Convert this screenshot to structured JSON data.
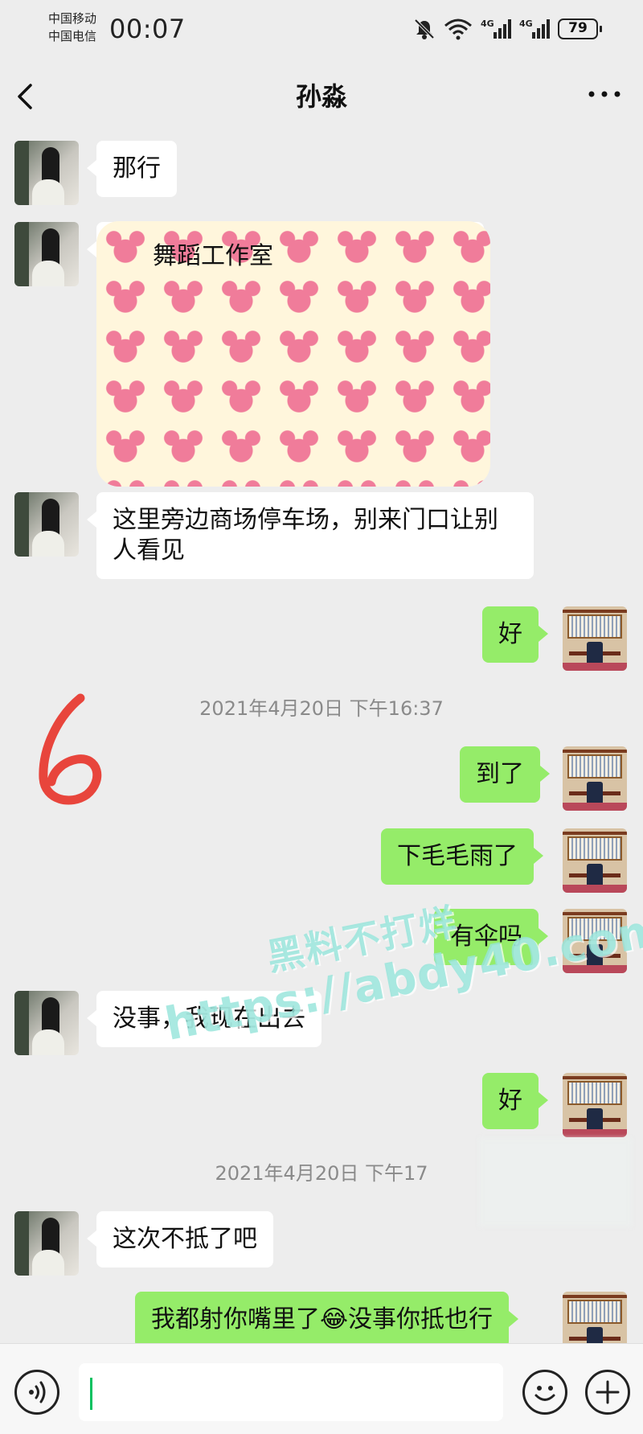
{
  "status_bar": {
    "carrier_1": "中国移动",
    "carrier_2": "中国电信",
    "time": "00:07",
    "battery": "79",
    "icons": [
      "mute-bell-icon",
      "wifi-icon",
      "signal-4g-icon",
      "signal-4g-icon",
      "battery-icon"
    ]
  },
  "header": {
    "title": "孙淼",
    "back_icon": "chevron-left-icon",
    "more_icon": "more-dots-icon"
  },
  "messages": {
    "m1": "那行",
    "m2_card_title": "舞蹈工作室",
    "m3": "这里旁边商场停车场，别来门口让别人看见",
    "m4": "好",
    "ts1": "2021年4月20日 下午16:37",
    "m5": "到了",
    "m6": "下毛毛雨了",
    "m7": "有伞吗",
    "m8": "没事，我现在出去",
    "m9": "好",
    "ts2": "2021年4月20日 下午17",
    "m10": "这次不抵了吧",
    "m11_before": "我都射你嘴里了",
    "m11_emoji": "😂",
    "m11_after": "没事你抵也行"
  },
  "annotation": {
    "number": "6"
  },
  "watermark": {
    "line1": "黑料不打烊",
    "line2": "https://abdy40.com"
  },
  "input_bar": {
    "voice_icon": "voice-icon",
    "emoji_icon": "smiley-icon",
    "plus_icon": "plus-icon",
    "value": ""
  },
  "colors": {
    "background": "#ededed",
    "incoming_bubble": "#ffffff",
    "outgoing_bubble": "#95ec69",
    "timestamp": "#8a8a8a",
    "cursor": "#07c160",
    "annotation": "#e8453c"
  }
}
